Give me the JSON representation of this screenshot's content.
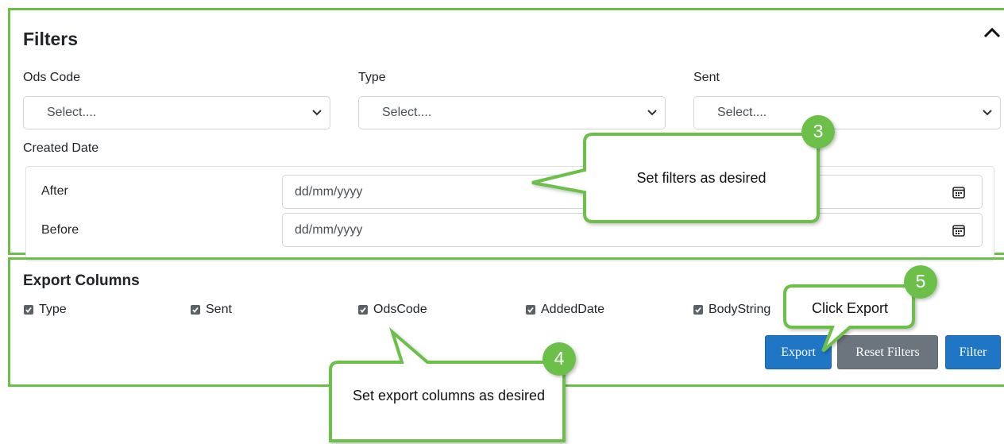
{
  "filters": {
    "title": "Filters",
    "ods_code": {
      "label": "Ods Code",
      "value": "Select...."
    },
    "type": {
      "label": "Type",
      "value": "Select...."
    },
    "sent": {
      "label": "Sent",
      "value": "Select...."
    },
    "created_date": {
      "label": "Created Date",
      "after": {
        "label": "After",
        "placeholder": "dd/mm/yyyy"
      },
      "before": {
        "label": "Before",
        "placeholder": "dd/mm/yyyy"
      }
    }
  },
  "export_columns": {
    "title": "Export Columns",
    "items": [
      {
        "label": "Type",
        "checked": true
      },
      {
        "label": "Sent",
        "checked": true
      },
      {
        "label": "OdsCode",
        "checked": true
      },
      {
        "label": "AddedDate",
        "checked": true
      },
      {
        "label": "BodyString",
        "checked": true
      }
    ]
  },
  "buttons": {
    "export": "Export",
    "reset": "Reset Filters",
    "filter": "Filter"
  },
  "annotations": {
    "step3": {
      "number": "3",
      "text": "Set filters as desired"
    },
    "step4": {
      "number": "4",
      "text": "Set export columns as desired"
    },
    "step5": {
      "number": "5",
      "text": "Click Export"
    }
  },
  "colors": {
    "annotation_green": "#6cc04a",
    "primary": "#1f76c5",
    "secondary": "#6c757d"
  },
  "icons": [
    "chevron-up-icon",
    "chevron-down-icon",
    "calendar-icon",
    "checkbox-checked-icon"
  ]
}
